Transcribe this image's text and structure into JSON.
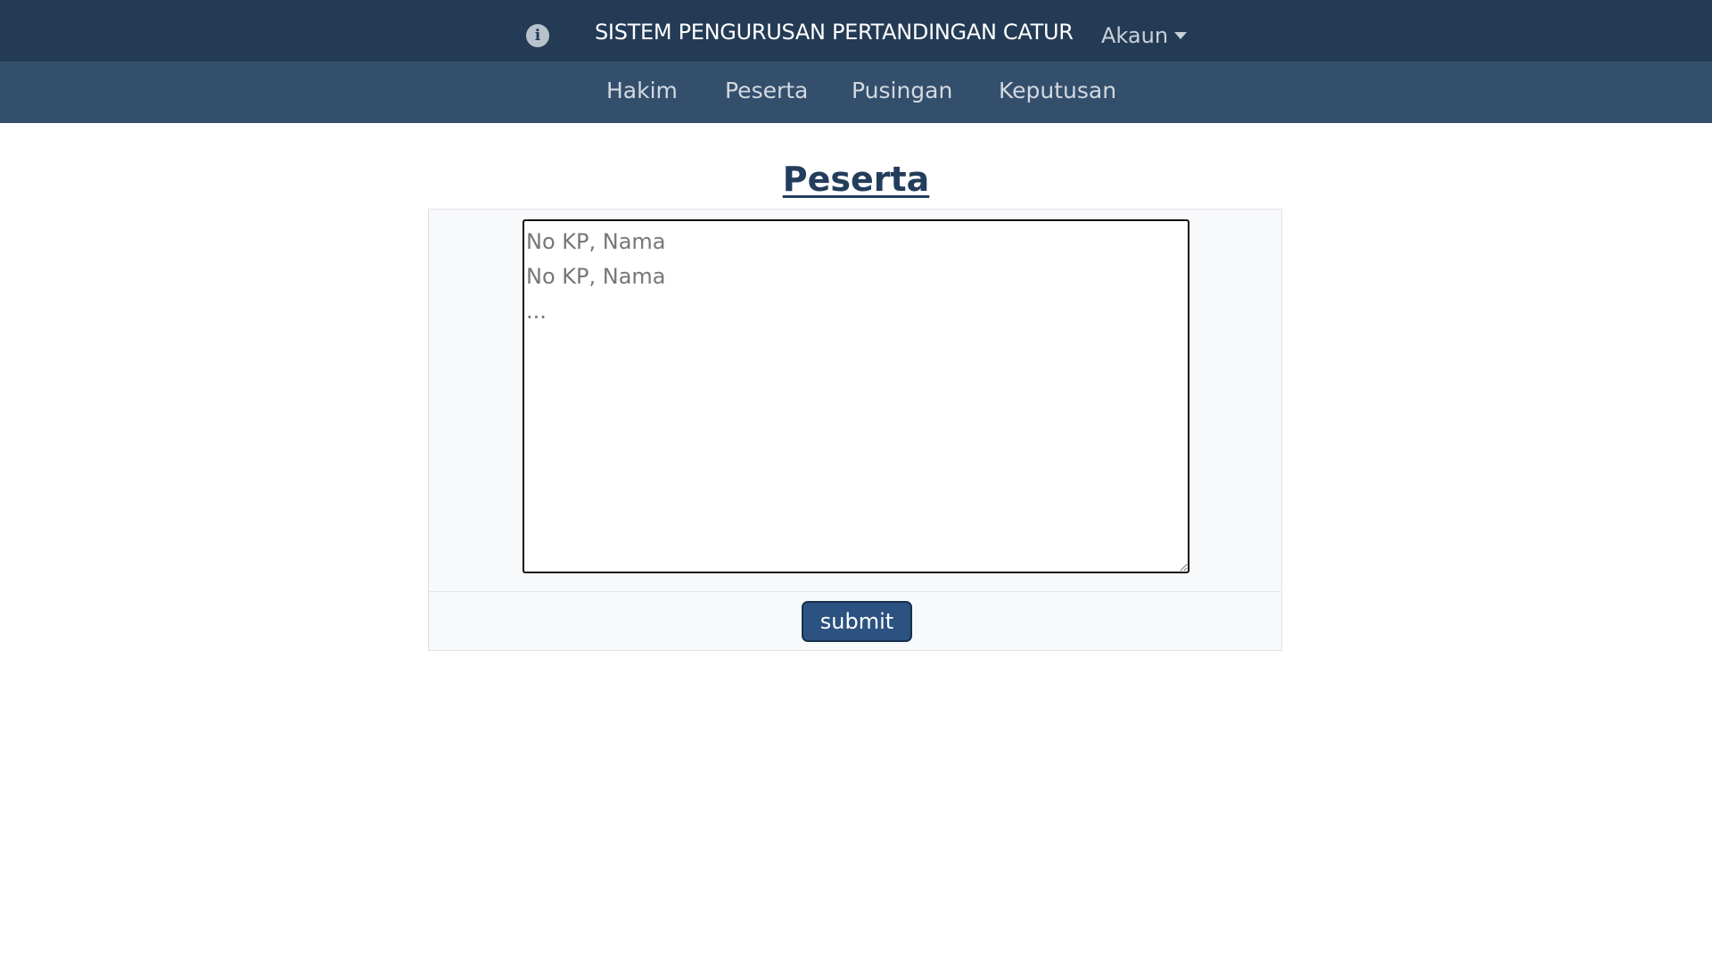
{
  "header": {
    "info_icon": "info-circle-icon",
    "app_title": "SISTEM PENGURUSAN PERTANDINGAN CATUR",
    "account_label": "Akaun",
    "account_icon": "caret-down-icon"
  },
  "nav": {
    "items": [
      {
        "label": "Hakim"
      },
      {
        "label": "Peserta"
      },
      {
        "label": "Pusingan"
      },
      {
        "label": "Keputusan"
      }
    ]
  },
  "main": {
    "title": "Peserta",
    "textarea_value": "",
    "textarea_placeholder": "No KP, Nama\nNo KP, Nama\n...",
    "submit_label": "submit"
  },
  "colors": {
    "topbar": "#243b55",
    "navbar": "#344f6c",
    "title": "#233d5c",
    "button": "#2b5281"
  }
}
